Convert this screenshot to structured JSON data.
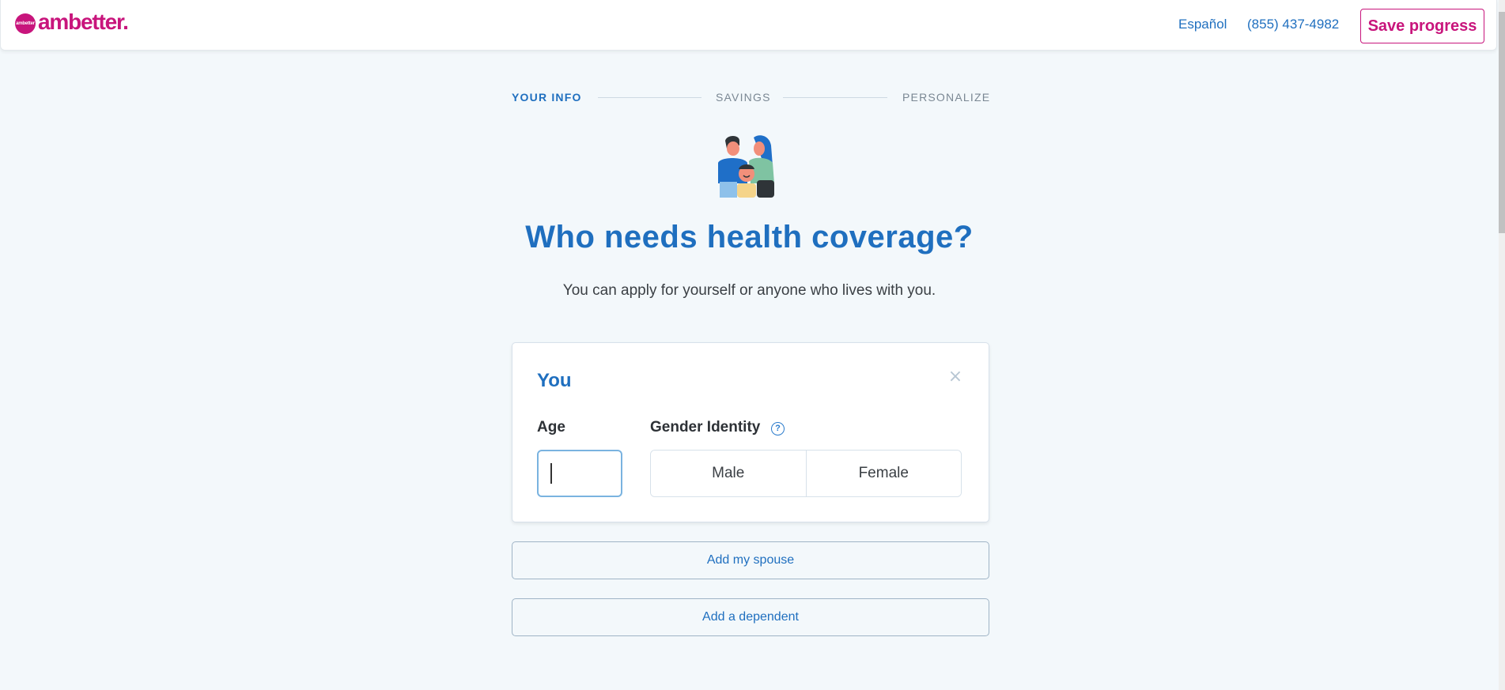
{
  "header": {
    "logo": {
      "badge_text": "ambetter",
      "wordmark": "ambetter."
    },
    "links": {
      "language": "Español",
      "phone": "(855) 437-4982"
    },
    "save_label": "Save progress"
  },
  "stepper": {
    "steps": [
      {
        "label": "YOUR INFO",
        "active": true
      },
      {
        "label": "SAVINGS",
        "active": false
      },
      {
        "label": "PERSONALIZE",
        "active": false
      }
    ]
  },
  "hero": {
    "illustration": "family-illustration",
    "title": "Who needs health coverage?",
    "subtitle": "You can apply for yourself or anyone who lives with you."
  },
  "applicant_card": {
    "title": "You",
    "close_icon": "×",
    "age": {
      "label": "Age",
      "value": "",
      "placeholder": ""
    },
    "gender": {
      "label": "Gender Identity",
      "help_icon": "?",
      "options": [
        "Male",
        "Female"
      ]
    }
  },
  "actions": {
    "add_spouse": "Add my spouse",
    "add_dependent": "Add a dependent"
  },
  "colors": {
    "brand_pink": "#c8157c",
    "primary_blue": "#1f6fbf",
    "background": "#f3f8fb"
  }
}
